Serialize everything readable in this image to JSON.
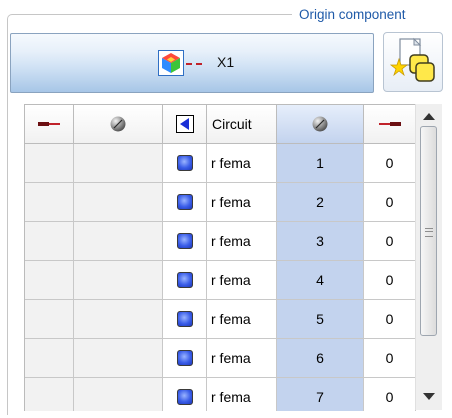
{
  "group": {
    "title": "Origin component"
  },
  "component": {
    "label": "X1",
    "icon": "component-cube-icon"
  },
  "pick_button": {
    "icon": "select-component-icon"
  },
  "table": {
    "headers": {
      "wire_left": {
        "icon": "wire-end-left-icon"
      },
      "pin_left": {
        "icon": "pin-ball-icon"
      },
      "direction": {
        "icon": "arrow-left-icon"
      },
      "circuit": "Circuit",
      "pin_right": {
        "icon": "pin-ball-icon"
      },
      "wire_right": {
        "icon": "wire-end-right-icon"
      }
    },
    "rows": [
      {
        "circuit": "r fema",
        "pin": "1",
        "value": "0"
      },
      {
        "circuit": "r fema",
        "pin": "2",
        "value": "0"
      },
      {
        "circuit": "r fema",
        "pin": "3",
        "value": "0"
      },
      {
        "circuit": "r fema",
        "pin": "4",
        "value": "0"
      },
      {
        "circuit": "r fema",
        "pin": "5",
        "value": "0"
      },
      {
        "circuit": "r fema",
        "pin": "6",
        "value": "0"
      },
      {
        "circuit": "r fema",
        "pin": "7",
        "value": "0"
      }
    ]
  },
  "colors": {
    "accent": "#1f5aa8",
    "selected_column": "#c3d3ee",
    "row_marker": "#3a5de8",
    "wire": "#c0222a"
  }
}
